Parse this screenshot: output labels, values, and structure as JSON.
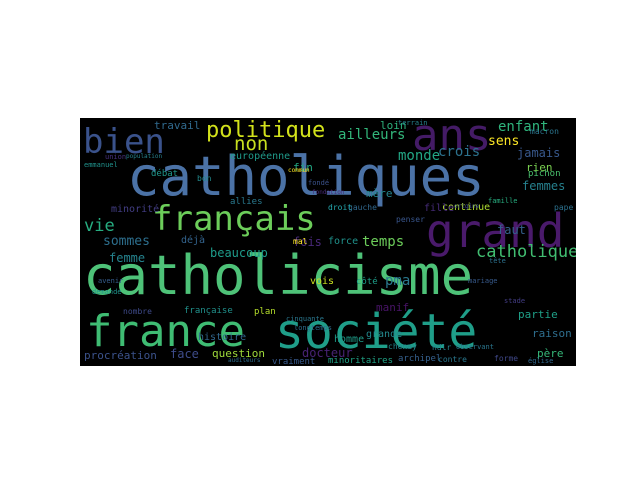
{
  "cloud": {
    "words": [
      {
        "text": "catholicisme",
        "color": "#4ec278"
      },
      {
        "text": "catholiques",
        "color": "#4b72a6"
      },
      {
        "text": "société",
        "color": "#1f9e89"
      },
      {
        "text": "france",
        "color": "#3fbc73"
      },
      {
        "text": "grand",
        "color": "#4a1a6b"
      },
      {
        "text": "ans",
        "color": "#441b66"
      },
      {
        "text": "français",
        "color": "#6ccd5a"
      },
      {
        "text": "bien",
        "color": "#3a528b"
      },
      {
        "text": "politique",
        "color": "#d2e21b"
      },
      {
        "text": "non",
        "color": "#c8e020"
      },
      {
        "text": "catholique",
        "color": "#41be71"
      },
      {
        "text": "enfant",
        "color": "#2fb47c"
      },
      {
        "text": "ailleurs",
        "color": "#32b67a"
      },
      {
        "text": "sommes",
        "color": "#2d6f8e"
      },
      {
        "text": "temps",
        "color": "#6ccd5a"
      },
      {
        "text": "vie",
        "color": "#27ad81"
      },
      {
        "text": "monde",
        "color": "#22a785"
      },
      {
        "text": "crois",
        "color": "#2c728e"
      },
      {
        "text": "sens",
        "color": "#fde725"
      },
      {
        "text": "femmes",
        "color": "#26818e"
      },
      {
        "text": "femme",
        "color": "#25838e"
      },
      {
        "text": "beaucoup",
        "color": "#1e9b8a"
      },
      {
        "text": "fois",
        "color": "#482878"
      },
      {
        "text": "faut",
        "color": "#34618d"
      },
      {
        "text": "pma",
        "color": "#2a788e"
      },
      {
        "text": "jamais",
        "color": "#38588c"
      },
      {
        "text": "rien",
        "color": "#7ad151"
      },
      {
        "text": "mère",
        "color": "#25858e"
      },
      {
        "text": "manif",
        "color": "#481467"
      },
      {
        "text": "face",
        "color": "#3e4c8a"
      },
      {
        "text": "question",
        "color": "#9fda3a"
      },
      {
        "text": "procréation",
        "color": "#3b528b"
      },
      {
        "text": "père",
        "color": "#35b779"
      },
      {
        "text": "raison",
        "color": "#2e6e8e"
      },
      {
        "text": "partie",
        "color": "#1fa088"
      },
      {
        "text": "loin",
        "color": "#2db27d"
      },
      {
        "text": "fin",
        "color": "#22a884"
      },
      {
        "text": "travail",
        "color": "#306a8e"
      },
      {
        "text": "européenne",
        "color": "#1f9a8a"
      },
      {
        "text": "minorité",
        "color": "#433e85"
      },
      {
        "text": "histoire",
        "color": "#31678e"
      },
      {
        "text": "docteur",
        "color": "#482374"
      },
      {
        "text": "homme",
        "color": "#1e9c89"
      },
      {
        "text": "déjà",
        "color": "#33638d"
      },
      {
        "text": "force",
        "color": "#20928c"
      },
      {
        "text": "vois",
        "color": "#cae11f"
      },
      {
        "text": "continue",
        "color": "#addc30"
      },
      {
        "text": "fille",
        "color": "#472c7a"
      },
      {
        "text": "débat",
        "color": "#1f968b"
      },
      {
        "text": "allies",
        "color": "#29798e"
      },
      {
        "text": "grande",
        "color": "#23898e"
      },
      {
        "text": "vraiment",
        "color": "#38598c"
      },
      {
        "text": "minoritaires",
        "color": "#20a386"
      },
      {
        "text": "archipel",
        "color": "#35608d"
      },
      {
        "text": "contre",
        "color": "#2a788e"
      },
      {
        "text": "forme",
        "color": "#3f4788"
      },
      {
        "text": "chenay",
        "color": "#23888e"
      },
      {
        "text": "française",
        "color": "#21918c"
      },
      {
        "text": "plan",
        "color": "#b5de2b"
      },
      {
        "text": "côté",
        "color": "#1e9d89"
      },
      {
        "text": "terrain",
        "color": "#26828e"
      },
      {
        "text": "pichon",
        "color": "#4ac16d"
      },
      {
        "text": "macron",
        "color": "#2b758e"
      },
      {
        "text": "gauche",
        "color": "#31688e"
      },
      {
        "text": "droit",
        "color": "#25abb2"
      },
      {
        "text": "bon",
        "color": "#238a8d"
      },
      {
        "text": "union",
        "color": "#46317e"
      },
      {
        "text": "mal",
        "color": "#fde725"
      },
      {
        "text": "ndlr",
        "color": "#26838e"
      },
      {
        "text": "observant",
        "color": "#2a768e"
      },
      {
        "text": "nombre",
        "color": "#3e4a89"
      },
      {
        "text": "penser",
        "color": "#39568c"
      },
      {
        "text": "pape",
        "color": "#2c718e"
      },
      {
        "text": "emmanuel",
        "color": "#20928c"
      },
      {
        "text": "population",
        "color": "#26828e"
      },
      {
        "text": "avenir",
        "color": "#365d8d"
      },
      {
        "text": "cinquante",
        "color": "#2a778e"
      },
      {
        "text": "longtemps",
        "color": "#2e6d8e"
      },
      {
        "text": "demande",
        "color": "#1f948c"
      },
      {
        "text": "fondé",
        "color": "#3b528b"
      },
      {
        "text": "église",
        "color": "#31688e"
      },
      {
        "text": "famille",
        "color": "#28ae80"
      },
      {
        "text": "auditeurs",
        "color": "#2f6c8e"
      },
      {
        "text": "commun",
        "color": "#fde725"
      },
      {
        "text": "fondation",
        "color": "#482979"
      },
      {
        "text": "origine",
        "color": "#3d4e8a"
      },
      {
        "text": "tête",
        "color": "#2c718e"
      },
      {
        "text": "mariage",
        "color": "#375a8c"
      },
      {
        "text": "stade",
        "color": "#433d84"
      }
    ]
  }
}
